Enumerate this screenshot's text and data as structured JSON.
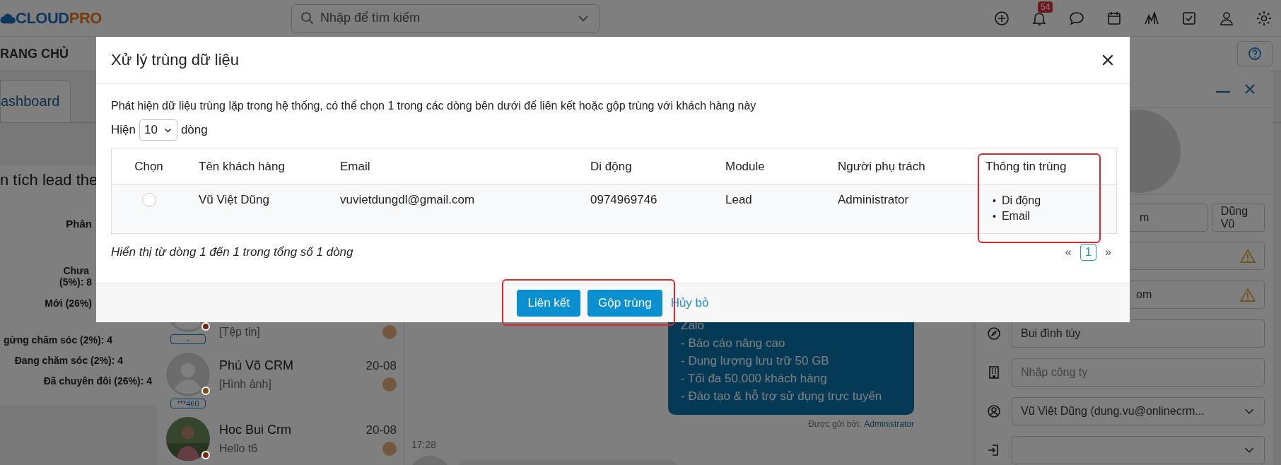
{
  "header": {
    "logo": {
      "part1": "CLOUD",
      "part2": "PRO"
    },
    "search": {
      "placeholder": "Nhập để tìm kiếm"
    },
    "notification_count": "54"
  },
  "breadcrumb": "RANG CHỦ",
  "tabs": [
    {
      "label": "ashboard",
      "selected": true
    }
  ],
  "chart_panel": {
    "title": "n tích lead the",
    "subtitle": "Phân",
    "labels": [
      "Chưa",
      "(5%): 8",
      "Mới (26%)",
      "gừng chăm sóc (2%): 4",
      "Đang chăm sóc (2%): 4",
      "Đã chuyên đôi (26%): 4"
    ]
  },
  "chat": {
    "contacts": [
      {
        "preview": "[Tệp tin]",
        "badge": "-",
        "color": "#742a15"
      },
      {
        "name": "Phú Võ CRM",
        "date": "20-08",
        "preview": "[Hình ảnh]",
        "badge": "***460",
        "color": "#785010"
      },
      {
        "name": "Hoc Bui Crm",
        "date": "20-08",
        "preview": "Hello t6",
        "color": "#742a15"
      }
    ],
    "message": {
      "lines": [
        "Zalo",
        "- Báo cáo nâng cao",
        "- Dung lượng lưu trữ 50 GB",
        "- Tối đa 50.000 khách hàng",
        "- Đào tạo & hỗ trợ sử dụng trực tuyến"
      ],
      "sent_by_label": "Được gửi bởi:",
      "sent_by": "Administrator"
    },
    "time": "17:28"
  },
  "contact_panel": {
    "fields": [
      {
        "kind": "pair",
        "values": [
          "m",
          "Dũng Vũ"
        ],
        "warning": false
      },
      {
        "kind": "text",
        "warning": true
      },
      {
        "kind": "text",
        "value": "om",
        "warning": true
      },
      {
        "kind": "text",
        "value": "Bui đình túy",
        "warning": false
      },
      {
        "kind": "text",
        "placeholder": "Nhập công ty",
        "warning": false
      },
      {
        "kind": "select",
        "value": "Vũ Việt Dũng (dung.vu@onlinecrm...",
        "warning": false
      },
      {
        "kind": "select",
        "warning": false
      }
    ]
  },
  "modal": {
    "title": "Xử lý trùng dữ liệu",
    "description": "Phát hiện dữ liệu trùng lặp trong hệ thống, có thể chọn 1 trong các dòng bên dưới để liên kết hoặc gộp trùng với khách hàng này",
    "page_size": {
      "label_before": "Hiện",
      "value": "10",
      "label_after": "dòng"
    },
    "columns": [
      "Chọn",
      "Tên khách hàng",
      "Email",
      "Di động",
      "Module",
      "Người phụ trách",
      "Thông tin trùng"
    ],
    "rows": [
      {
        "selected": false,
        "cells": [
          "",
          "Vũ Việt Dũng",
          "vuvietdungdl@gmail.com",
          "0974969746",
          "Lead",
          "Administrator"
        ],
        "bullet": "•",
        "duplicates": [
          "Di động",
          "Email"
        ]
      }
    ],
    "summary": "Hiển thị từ dòng 1 đến 1 trong tổng số 1 dòng",
    "pagination": {
      "prev": "«",
      "pages": [
        {
          "label": "1",
          "selected": true
        }
      ],
      "next": "»"
    },
    "buttons": [
      "Liên kết",
      "Gộp trùng"
    ],
    "cancel": "Hủy bỏ"
  }
}
